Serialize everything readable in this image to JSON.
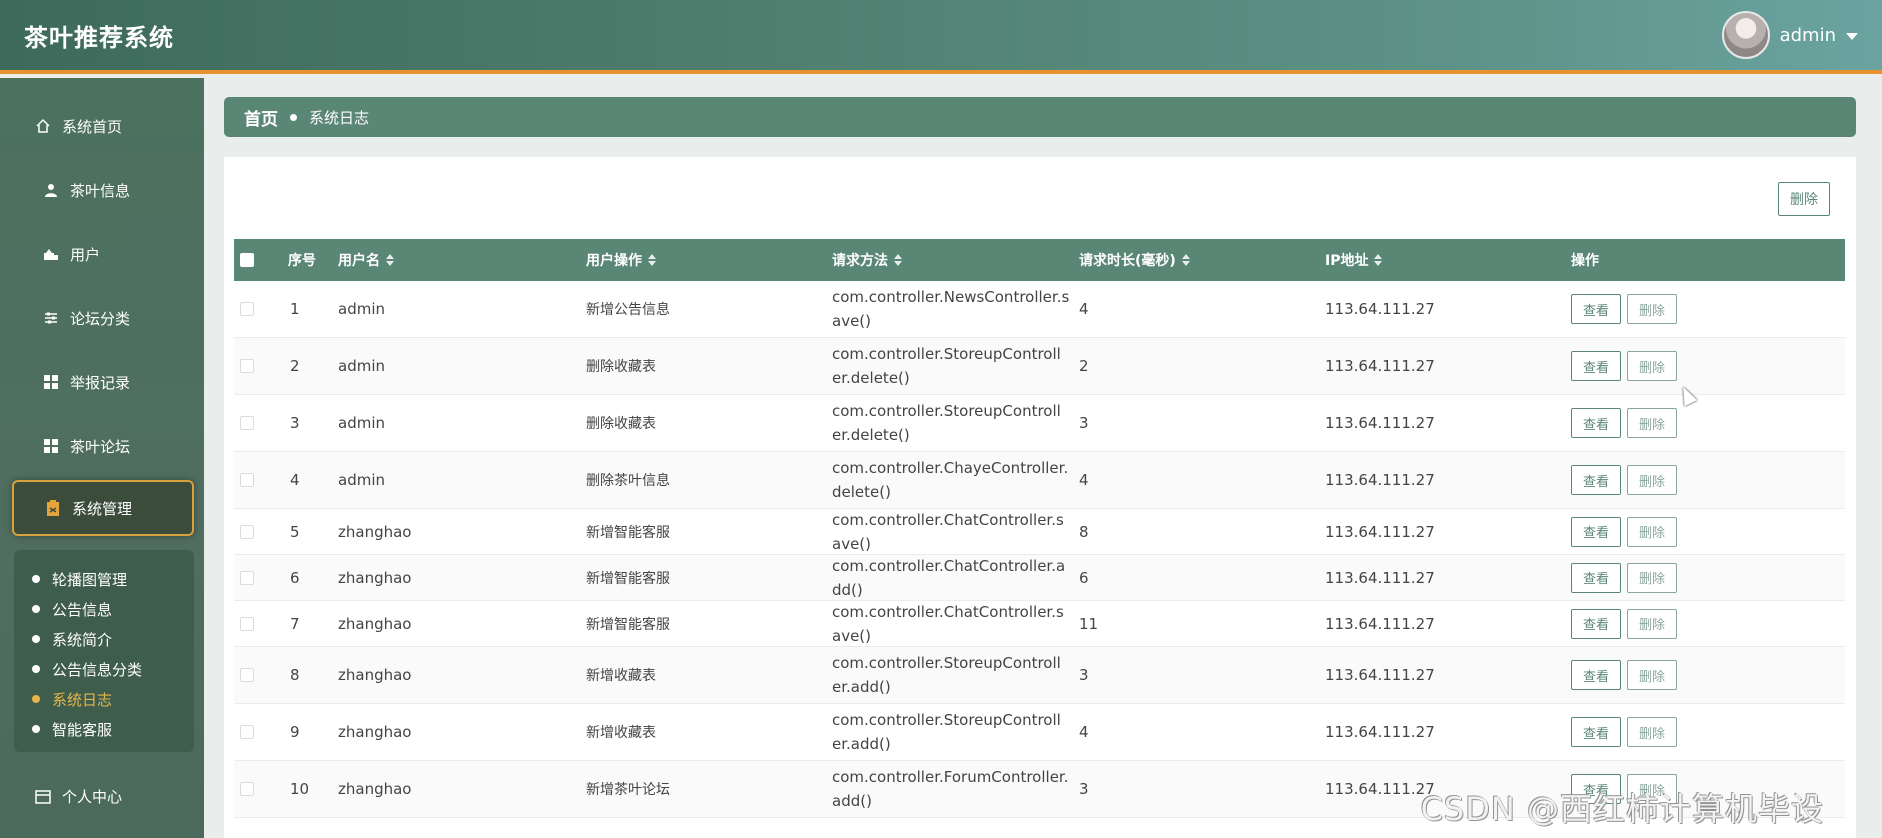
{
  "app": {
    "title": "茶叶推荐系统"
  },
  "user": {
    "name": "admin"
  },
  "sidebar": {
    "items": [
      {
        "label": "系统首页",
        "icon": "home-icon"
      },
      {
        "label": "茶叶信息",
        "icon": "person-icon"
      },
      {
        "label": "用户",
        "icon": "user-group-icon"
      },
      {
        "label": "论坛分类",
        "icon": "sliders-icon"
      },
      {
        "label": "举报记录",
        "icon": "grid-icon"
      },
      {
        "label": "茶叶论坛",
        "icon": "grid-icon"
      },
      {
        "label": "系统管理",
        "icon": "clipboard-icon"
      },
      {
        "label": "个人中心",
        "icon": "calendar-icon"
      }
    ],
    "submenu": [
      {
        "label": "轮播图管理"
      },
      {
        "label": "公告信息"
      },
      {
        "label": "系统简介"
      },
      {
        "label": "公告信息分类"
      },
      {
        "label": "系统日志"
      },
      {
        "label": "智能客服"
      }
    ],
    "active_item": "系统管理",
    "active_sub": "系统日志"
  },
  "breadcrumb": {
    "home": "首页",
    "current": "系统日志"
  },
  "toolbar": {
    "delete_label": "删除"
  },
  "table": {
    "columns": [
      "序号",
      "用户名",
      "用户操作",
      "请求方法",
      "请求时长(毫秒)",
      "IP地址",
      "操作"
    ],
    "rows": [
      {
        "no": "1",
        "user": "admin",
        "op": "新增公告信息",
        "method": "com.controller.NewsController.save()",
        "duration": "4",
        "ip": "113.64.111.27"
      },
      {
        "no": "2",
        "user": "admin",
        "op": "删除收藏表",
        "method": "com.controller.StoreupController.delete()",
        "duration": "2",
        "ip": "113.64.111.27"
      },
      {
        "no": "3",
        "user": "admin",
        "op": "删除收藏表",
        "method": "com.controller.StoreupController.delete()",
        "duration": "3",
        "ip": "113.64.111.27"
      },
      {
        "no": "4",
        "user": "admin",
        "op": "删除茶叶信息",
        "method": "com.controller.ChayeController.delete()",
        "duration": "4",
        "ip": "113.64.111.27"
      },
      {
        "no": "5",
        "user": "zhanghao",
        "op": "新增智能客服",
        "method": "com.controller.ChatController.save()",
        "duration": "8",
        "ip": "113.64.111.27"
      },
      {
        "no": "6",
        "user": "zhanghao",
        "op": "新增智能客服",
        "method": "com.controller.ChatController.add()",
        "duration": "6",
        "ip": "113.64.111.27"
      },
      {
        "no": "7",
        "user": "zhanghao",
        "op": "新增智能客服",
        "method": "com.controller.ChatController.save()",
        "duration": "11",
        "ip": "113.64.111.27"
      },
      {
        "no": "8",
        "user": "zhanghao",
        "op": "新增收藏表",
        "method": "com.controller.StoreupController.add()",
        "duration": "3",
        "ip": "113.64.111.27"
      },
      {
        "no": "9",
        "user": "zhanghao",
        "op": "新增收藏表",
        "method": "com.controller.StoreupController.add()",
        "duration": "4",
        "ip": "113.64.111.27"
      },
      {
        "no": "10",
        "user": "zhanghao",
        "op": "新增茶叶论坛",
        "method": "com.controller.ForumController.add()",
        "duration": "3",
        "ip": "113.64.111.27"
      }
    ],
    "view_label": "查看",
    "delete_label": "删除"
  },
  "watermark": "CSDN @西红柿计算机毕设",
  "colors": {
    "header": "#5a8676",
    "accent": "#e6922e",
    "active_sub": "#e5b54a"
  }
}
